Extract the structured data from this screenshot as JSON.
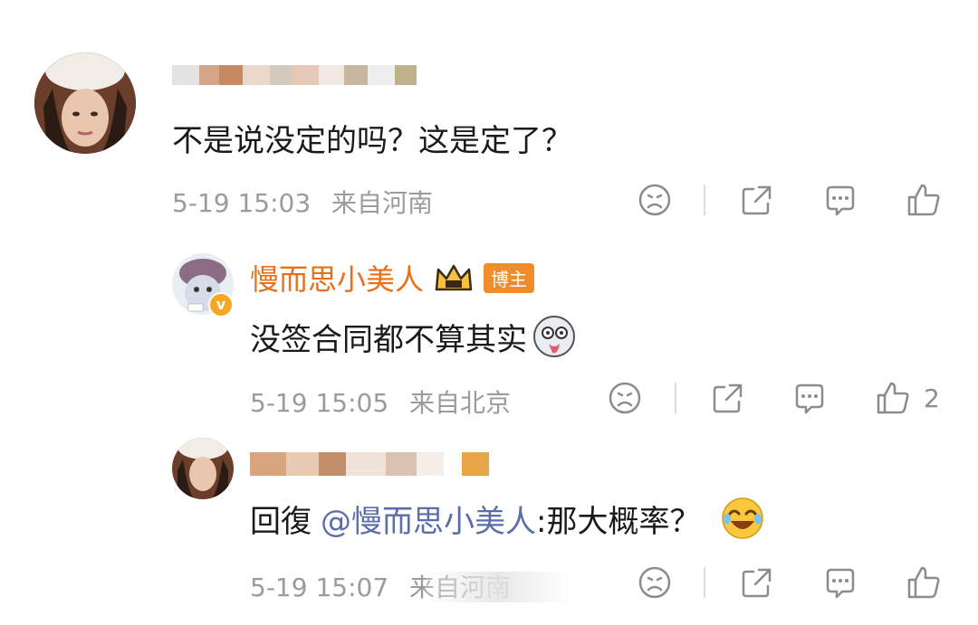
{
  "comments": [
    {
      "text": "不是说没定的吗？这是定了？",
      "time": "5-19 15:03",
      "location": "来自河南",
      "likes": ""
    },
    {
      "username": "慢而思小美人",
      "badge": "博主",
      "text": "没签合同都不算其实",
      "time": "5-19 15:05",
      "location": "来自北京",
      "likes": "2"
    },
    {
      "reply_prefix": "回復",
      "mention": "@慢而思小美人",
      "reply_body": ":那大概率？",
      "time": "5-19 15:07",
      "location": "来自河南",
      "likes": ""
    }
  ],
  "icons": {
    "dislike": "sad-face-icon",
    "share": "share-icon",
    "comment": "comment-icon",
    "like": "thumbs-up-icon"
  },
  "colors": {
    "username": "#e8701a",
    "mention": "#5a6ea8",
    "meta": "#9b9b9b",
    "badge": "#f08c2a"
  }
}
